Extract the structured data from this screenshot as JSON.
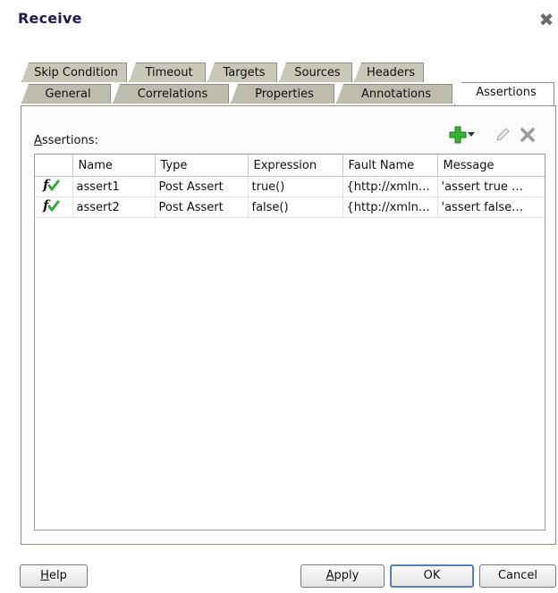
{
  "dialog": {
    "title": "Receive",
    "close_icon": "close-icon"
  },
  "tabs": {
    "row1": [
      "Skip Condition",
      "Timeout",
      "Targets",
      "Sources",
      "Headers"
    ],
    "row2": [
      "General",
      "Correlations",
      "Properties",
      "Annotations",
      "Assertions"
    ],
    "active": "Assertions"
  },
  "assertions": {
    "label_prefix": "A",
    "label_rest": "ssertions:",
    "toolbar": {
      "add_icon": "add-plus-icon",
      "dropdown_icon": "dropdown-arrow-icon",
      "edit_icon": "edit-pencil-icon",
      "delete_icon": "delete-x-icon"
    },
    "columns": [
      "Name",
      "Type",
      "Expression",
      "Fault Name",
      "Message"
    ],
    "rows": [
      {
        "icon": "function-check-icon",
        "name": "assert1",
        "type": "Post Assert",
        "expression": "true()",
        "fault_name": "{http://xmln…",
        "message": "'assert true …"
      },
      {
        "icon": "function-check-icon",
        "name": "assert2",
        "type": "Post Assert",
        "expression": "false()",
        "fault_name": "{http://xmln…",
        "message": "'assert false…"
      }
    ]
  },
  "buttons": {
    "help_first": "H",
    "help_rest": "elp",
    "apply_first": "A",
    "apply_rest": "pply",
    "ok": "OK",
    "cancel": "Cancel"
  },
  "colors": {
    "tab_bg": "#c8c7b8",
    "add_green": "#2fa52f",
    "check_green": "#3aa63a"
  }
}
